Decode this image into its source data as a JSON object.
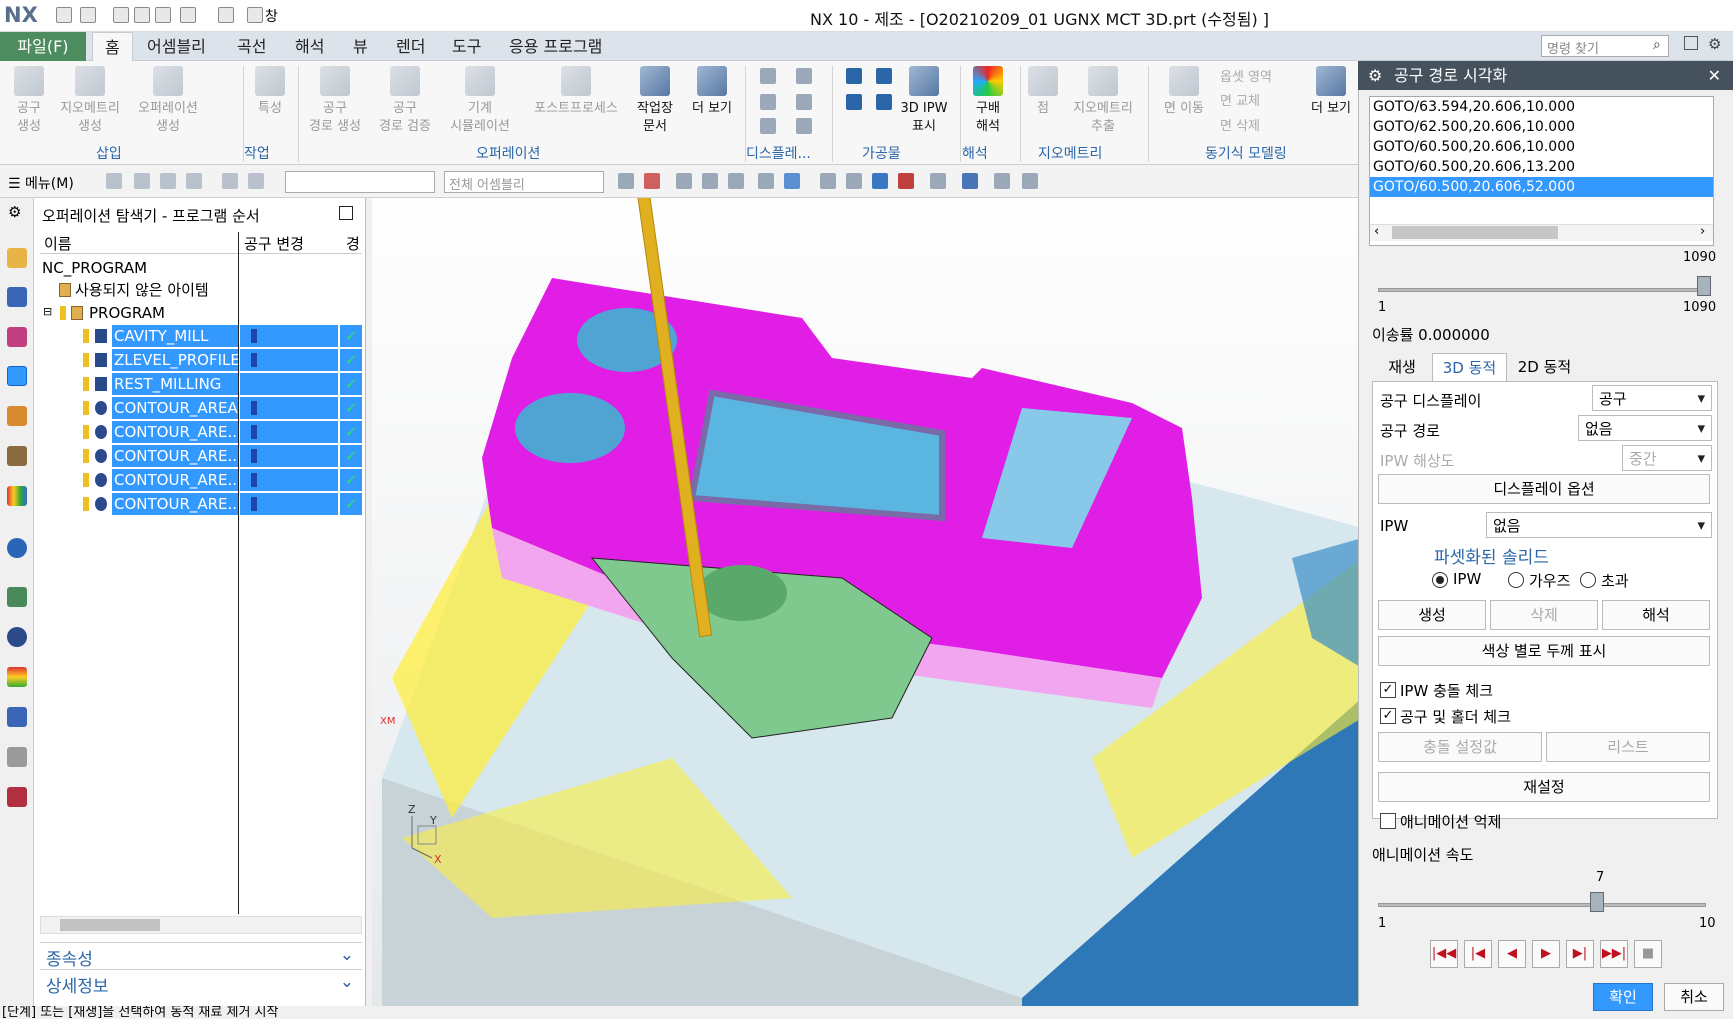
{
  "titlebar": {
    "logo": "NX",
    "title": "NX 10 - 제조 - [O20210209_01 UGNX MCT 3D.prt (수정됨) ]",
    "window_menu": "창"
  },
  "menubar": {
    "file_tab": "파일(F)",
    "tabs": [
      "홈",
      "어셈블리",
      "곡선",
      "해석",
      "뷰",
      "렌더",
      "도구",
      "응용 프로그램"
    ],
    "search_placeholder": "명령 찾기"
  },
  "ribbon": {
    "buttons": [
      {
        "label": "공구\n생성",
        "enabled": false
      },
      {
        "label": "지오메트리\n생성",
        "enabled": false
      },
      {
        "label": "오퍼레이션\n생성",
        "enabled": false
      },
      {
        "label": "특성",
        "enabled": false
      },
      {
        "label": "공구\n경로 생성",
        "enabled": false
      },
      {
        "label": "공구\n경로 검증",
        "enabled": false
      },
      {
        "label": "기계\n시뮬레이션",
        "enabled": false
      },
      {
        "label": "포스트프로세스",
        "enabled": false
      },
      {
        "label": "작업장\n문서",
        "enabled": true
      },
      {
        "label": "더 보기",
        "enabled": true
      },
      {
        "label": "3D IPW\n표시",
        "enabled": true
      },
      {
        "label": "구배\n해석",
        "enabled": true
      },
      {
        "label": "점",
        "enabled": false
      },
      {
        "label": "지오메트리\n추출",
        "enabled": false
      },
      {
        "label": "면 이동",
        "enabled": false
      },
      {
        "label": "더 보기",
        "enabled": true
      }
    ],
    "sync_items": [
      "옵셋 영역",
      "면 교체",
      "면 삭제"
    ],
    "groups": [
      "삽입",
      "작업",
      "오퍼레이션",
      "디스플레...",
      "가공물",
      "해석",
      "지오메트리",
      "동기식 모델링"
    ]
  },
  "toolbar2": {
    "menu_label": "메뉴(M)",
    "scope_placeholder": "전체 어셈블리"
  },
  "navigator": {
    "title": "오퍼레이션 탐색기 - 프로그램 순서",
    "columns": [
      "이름",
      "공구 변경",
      "경"
    ],
    "root": "NC_PROGRAM",
    "unused": "사용되지 않은 아이템",
    "program": "PROGRAM",
    "operations": [
      "CAVITY_MILL",
      "ZLEVEL_PROFILE",
      "REST_MILLING",
      "CONTOUR_AREA",
      "CONTOUR_ARE...",
      "CONTOUR_ARE...",
      "CONTOUR_ARE...",
      "CONTOUR_ARE..."
    ],
    "accordions": [
      "종속성",
      "상세정보"
    ]
  },
  "viewport": {
    "triad_z": "Z",
    "triad_y": "Y",
    "triad_x": "X",
    "xm_label": "XM"
  },
  "panel": {
    "title": "공구 경로 시각화",
    "goto_lines": [
      "GOTO/63.594,20.606,10.000",
      "GOTO/62.500,20.606,10.000",
      "GOTO/60.500,20.606,10.000",
      "GOTO/60.500,20.606,13.200",
      "GOTO/60.500,20.606,52.000"
    ],
    "goto_selected_index": 4,
    "slider1": {
      "current": "1090",
      "min": "1",
      "max": "1090"
    },
    "feed_rate_label": "이송률 0.000000",
    "tabs": [
      "재생",
      "3D 동적",
      "2D 동적"
    ],
    "tool_display_label": "공구 디스플레이",
    "tool_display_value": "공구",
    "tool_path_label": "공구 경로",
    "tool_path_value": "없음",
    "ipw_res_label": "IPW 해상도",
    "ipw_res_value": "중간",
    "display_options_btn": "디스플레이 옵션",
    "ipw_label": "IPW",
    "ipw_value": "없음",
    "faceted_solid": "파셋화된 솔리드",
    "radio_options": [
      "IPW",
      "가우즈",
      "초과"
    ],
    "create_btn": "생성",
    "delete_btn": "삭제",
    "analyze_btn": "해석",
    "thickness_color_btn": "색상 별로 두께 표시",
    "ipw_collision_chk": "IPW 충돌 체크",
    "tool_holder_chk": "공구 및 홀더 체크",
    "collision_settings_btn": "충돌 설정값",
    "list_btn": "리스트",
    "reset_btn": "재설정",
    "suppress_anim_chk": "애니메이션 억제",
    "anim_speed_label": "애니메이션 속도",
    "speed_slider": {
      "current": "7",
      "min": "1",
      "max": "10",
      "fraction": 0.667
    },
    "ok_btn": "확인",
    "cancel_btn": "취소"
  },
  "statusbar": {
    "text": "[단계] 또는 [재생]을 선택하여 동적 재료 제거 시작"
  }
}
